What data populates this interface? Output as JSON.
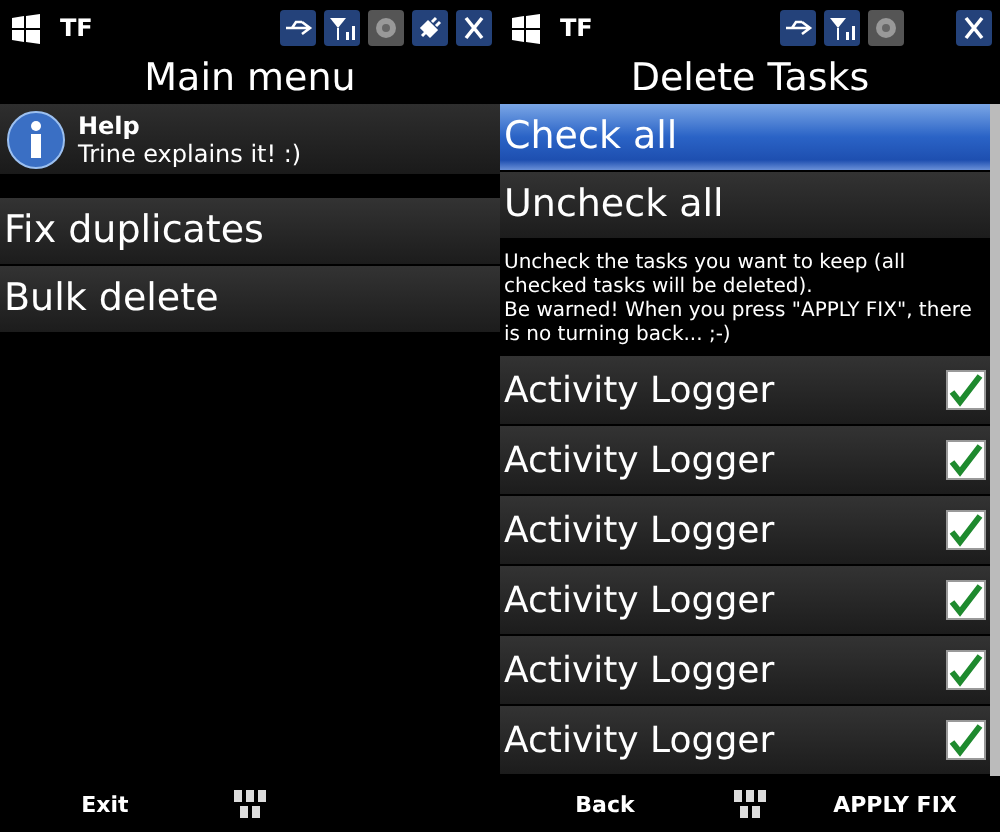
{
  "screens": [
    {
      "status": {
        "app": "TF",
        "charging": true
      },
      "title": "Main menu",
      "help": {
        "title": "Help",
        "subtitle": "Trine explains it! :)"
      },
      "menu": [
        {
          "label": "Fix duplicates",
          "selected": false
        },
        {
          "label": "Bulk delete",
          "selected": false
        }
      ],
      "softkeys": {
        "left": "Exit"
      }
    },
    {
      "status": {
        "app": "TF",
        "charging": false
      },
      "title": "Delete Tasks",
      "menu": [
        {
          "label": "Check all",
          "selected": true
        },
        {
          "label": "Uncheck all",
          "selected": false
        }
      ],
      "note": "Uncheck the tasks you want to keep (all checked tasks will be deleted).\nBe warned! When you press \"APPLY FIX\", there is no turning back... ;-)",
      "tasks": [
        {
          "label": "Activity Logger",
          "checked": true
        },
        {
          "label": "Activity Logger",
          "checked": true
        },
        {
          "label": "Activity Logger",
          "checked": true
        },
        {
          "label": "Activity Logger",
          "checked": true
        },
        {
          "label": "Activity Logger",
          "checked": true
        },
        {
          "label": "Activity Logger",
          "checked": true
        }
      ],
      "softkeys": {
        "left": "Back",
        "right": "APPLY FIX"
      }
    }
  ]
}
